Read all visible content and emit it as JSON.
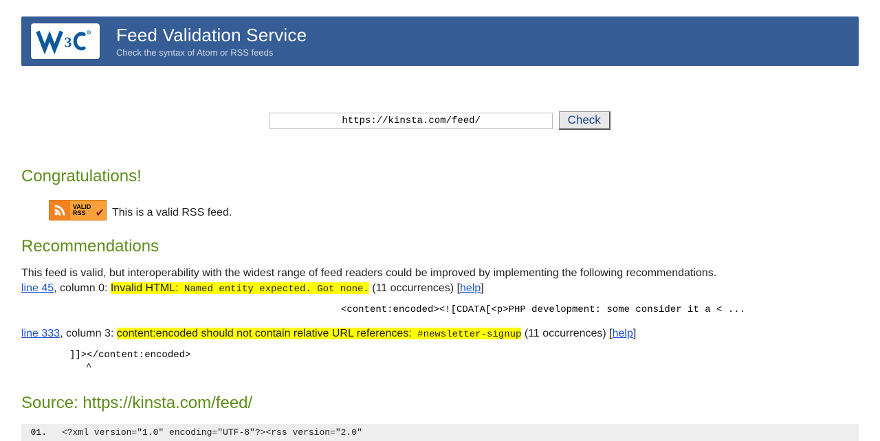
{
  "banner": {
    "title": "Feed Validation Service",
    "subtitle": "Check the syntax of Atom or RSS feeds"
  },
  "form": {
    "url_value": "https://kinsta.com/feed/",
    "check_label": "Check"
  },
  "result": {
    "congrats_heading": "Congratulations!",
    "badge_line1": "VALID",
    "badge_line2": "RSS",
    "valid_message": "This is a valid RSS feed."
  },
  "recs": {
    "heading": "Recommendations",
    "intro": "This feed is valid, but interoperability with the widest range of feed readers could be improved by implementing the following recommendations.",
    "items": [
      {
        "line_link": "line 45",
        "column_text": ", column 0: ",
        "highlight_main": "Invalid HTML:",
        "highlight_mono": " Named entity expected. Got none.",
        "occurrences": " (11 occurrences) ",
        "help": "help",
        "snippet": "<content:encoded><![CDATA[<p>PHP development: some consider it a < ..."
      },
      {
        "line_link": "line 333",
        "column_text": ", column 3: ",
        "highlight_main": "content:encoded should not contain relative URL references:",
        "highlight_mono": " #newsletter-signup",
        "occurrences": " (11 occurrences) ",
        "help": "help",
        "snippet": "]]></content:encoded>",
        "caret": "^"
      }
    ]
  },
  "source": {
    "heading_prefix": "Source: ",
    "url": "https://kinsta.com/feed/",
    "lines": [
      {
        "n": "01.",
        "code": "<?xml version=\"1.0\" encoding=\"UTF-8\"?><rss version=\"2.0\""
      }
    ]
  }
}
